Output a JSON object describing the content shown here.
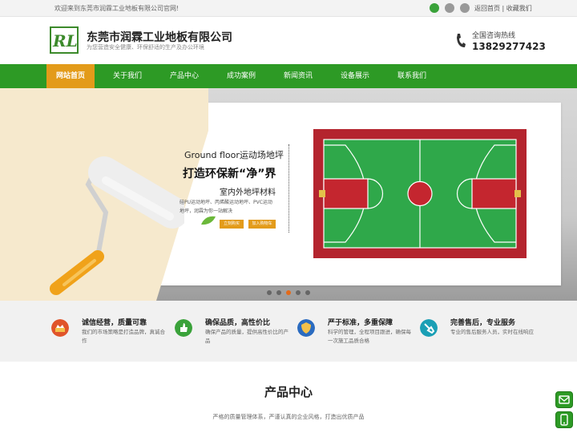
{
  "topbar": {
    "welcome": "欢迎来到东莞市润霖工业地板有限公司官网!",
    "home_link": "返回首页",
    "separator": "|",
    "fav_link": "收藏我们",
    "icons": [
      "qq-icon",
      "weibo-icon",
      "wechat-icon"
    ]
  },
  "header": {
    "logo_text": "RL",
    "company": "东莞市润霖工业地板有限公司",
    "slogan": "为您营造安全健康、环保舒适的生产及办公环境",
    "hotline_label": "全国咨询热线",
    "hotline_number": "13829277423"
  },
  "nav": {
    "items": [
      {
        "label": "网站首页",
        "active": true
      },
      {
        "label": "关于我们",
        "active": false
      },
      {
        "label": "产品中心",
        "active": false
      },
      {
        "label": "成功案例",
        "active": false
      },
      {
        "label": "新闻资讯",
        "active": false
      },
      {
        "label": "设备展示",
        "active": false
      },
      {
        "label": "联系我们",
        "active": false
      }
    ]
  },
  "hero": {
    "title1": "Ground floor运动场地坪",
    "title2": "打造环保新“净”界",
    "title3": "室内外地坪材料",
    "desc1": "硅PU运动地坪、丙烯酸运动地坪、PVC运动",
    "desc2": "地坪，润霖为你一站解决",
    "btn1": "立刻购买",
    "btn2": "加入购物车",
    "slides": 5,
    "active_slide": 3
  },
  "features": [
    {
      "title": "诚信经营，质量可靠",
      "desc": "我们的市场策略是打造品牌，真诚合作",
      "icon": "award-icon",
      "color": "#e0542a"
    },
    {
      "title": "确保品质，高性价比",
      "desc": "确保产品的质量，提供高性价比的产品",
      "icon": "thumbs-up-icon",
      "color": "#3aa23a"
    },
    {
      "title": "严于标准，多重保障",
      "desc": "科学的管理，全程项目跟进，确保每一次施工品质合格",
      "icon": "shield-icon",
      "color": "#2a6bc0"
    },
    {
      "title": "完善售后，专业服务",
      "desc": "专业的售后服务人员，实时在线响应",
      "icon": "service-icon",
      "color": "#1a9fb5"
    }
  ],
  "product_center": {
    "title": "产品中心",
    "subtitle": "严格的质量管理体系，严谨认真的企业风格，打造出优质产品"
  },
  "floating": [
    "message-icon",
    "phone-icon"
  ]
}
